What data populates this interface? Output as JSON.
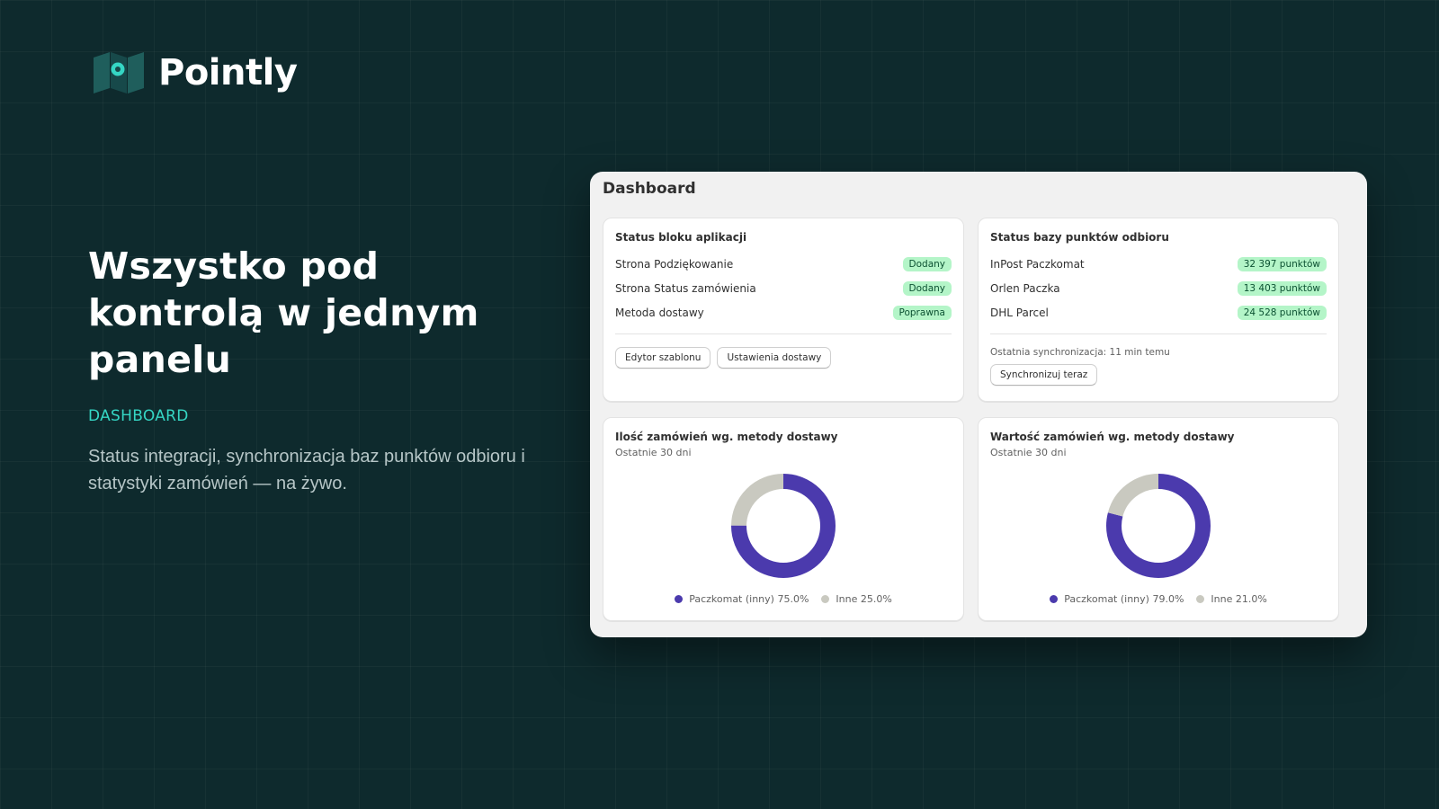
{
  "brand": {
    "name": "Pointly"
  },
  "hero": {
    "heading": "Wszystko pod kontrolą w jednym panelu",
    "tag": "DASHBOARD",
    "description": "Status integracji, synchronizacja baz punktów odbioru i statystyki zamówień — na żywo."
  },
  "colors": {
    "background": "#0e2a2d",
    "accent": "#35d6c4",
    "primary_series": "#4b3aad",
    "other_series": "#c9c9c0",
    "badge_bg": "#b4f5c8"
  },
  "dashboard": {
    "title": "Dashboard",
    "app_block": {
      "title": "Status bloku aplikacji",
      "rows": [
        {
          "label": "Strona Podziękowanie",
          "status": "Dodany"
        },
        {
          "label": "Strona Status zamówienia",
          "status": "Dodany"
        },
        {
          "label": "Metoda dostawy",
          "status": "Poprawna"
        }
      ],
      "buttons": [
        "Edytor szablonu",
        "Ustawienia dostawy"
      ]
    },
    "pickup_db": {
      "title": "Status bazy punktów odbioru",
      "rows": [
        {
          "label": "InPost Paczkomat",
          "status": "32 397 punktów"
        },
        {
          "label": "Orlen Paczka",
          "status": "13 403 punktów"
        },
        {
          "label": "DHL Parcel",
          "status": "24 528 punktów"
        }
      ],
      "last_sync": "Ostatnia synchronizacja: 11 min temu",
      "sync_button": "Synchronizuj teraz"
    },
    "orders_count": {
      "title": "Ilość zamówień wg. metody dostawy",
      "subtitle": "Ostatnie 30 dni",
      "legend": [
        "Paczkomat (inny) 75.0%",
        "Inne 25.0%"
      ]
    },
    "orders_value": {
      "title": "Wartość zamówień wg. metody dostawy",
      "subtitle": "Ostatnie 30 dni",
      "legend": [
        "Paczkomat (inny) 79.0%",
        "Inne 21.0%"
      ]
    }
  },
  "chart_data": [
    {
      "type": "pie",
      "title": "Ilość zamówień wg. metody dostawy",
      "subtitle": "Ostatnie 30 dni",
      "categories": [
        "Paczkomat (inny)",
        "Inne"
      ],
      "values": [
        75.0,
        25.0
      ],
      "colors": [
        "#4b3aad",
        "#c9c9c0"
      ],
      "donut": true,
      "legend": "bottom"
    },
    {
      "type": "pie",
      "title": "Wartość zamówień wg. metody dostawy",
      "subtitle": "Ostatnie 30 dni",
      "categories": [
        "Paczkomat (inny)",
        "Inne"
      ],
      "values": [
        79.0,
        21.0
      ],
      "colors": [
        "#4b3aad",
        "#c9c9c0"
      ],
      "donut": true,
      "legend": "bottom"
    }
  ]
}
